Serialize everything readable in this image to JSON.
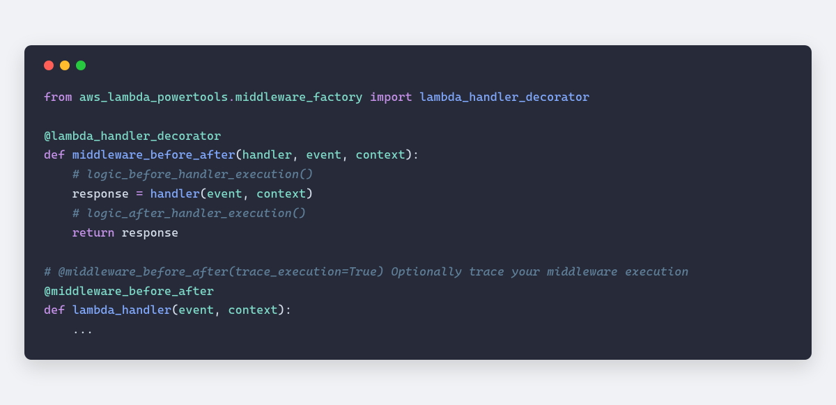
{
  "window": {
    "traffic_lights": [
      "close",
      "minimize",
      "zoom"
    ]
  },
  "code": {
    "l1": {
      "from": "from",
      "mod1": "aws_lambda_powertools",
      "dot": ".",
      "mod2": "middleware_factory",
      "import": "import",
      "target": "lambda_handler_decorator"
    },
    "l2": "",
    "l3": {
      "at": "@",
      "dec": "lambda_handler_decorator"
    },
    "l4": {
      "def": "def",
      "fn": "middleware_before_after",
      "lp": "(",
      "p1": "handler",
      "c1": ", ",
      "p2": "event",
      "c2": ", ",
      "p3": "context",
      "rp": "):"
    },
    "l5": {
      "indent": "    ",
      "comment": "# logic_before_handler_execution()"
    },
    "l6": {
      "indent": "    ",
      "var": "response",
      "eq": " = ",
      "call": "handler",
      "lp": "(",
      "a1": "event",
      "c1": ", ",
      "a2": "context",
      "rp": ")"
    },
    "l7": {
      "indent": "    ",
      "comment": "# logic_after_handler_execution()"
    },
    "l8": {
      "indent": "    ",
      "ret": "return",
      "sp": " ",
      "val": "response"
    },
    "l9": "",
    "l10": {
      "comment": "# @middleware_before_after(trace_execution=True) Optionally trace your middleware execution"
    },
    "l11": {
      "at": "@",
      "dec": "middleware_before_after"
    },
    "l12": {
      "def": "def",
      "fn": "lambda_handler",
      "lp": "(",
      "p1": "event",
      "c1": ", ",
      "p2": "context",
      "rp": "):"
    },
    "l13": {
      "indent": "    ",
      "body": "..."
    }
  }
}
